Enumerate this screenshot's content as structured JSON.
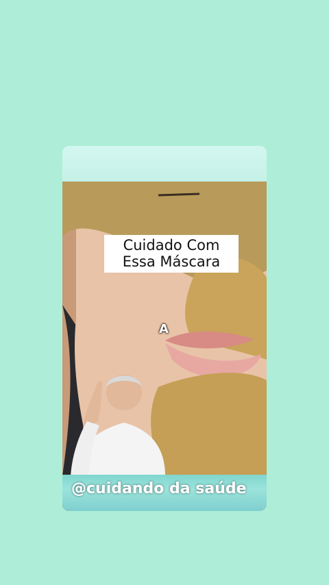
{
  "colors": {
    "background": "#aeeed9",
    "card_top": "#c9f3ea",
    "caption_bg": "#ffffff",
    "handle_text": "#ffffff"
  },
  "video": {
    "caption_line1": "Cuidado Com",
    "caption_line2": "Essa Máscara",
    "overlay_letter": "A",
    "handle": "@cuidando da saúde"
  }
}
